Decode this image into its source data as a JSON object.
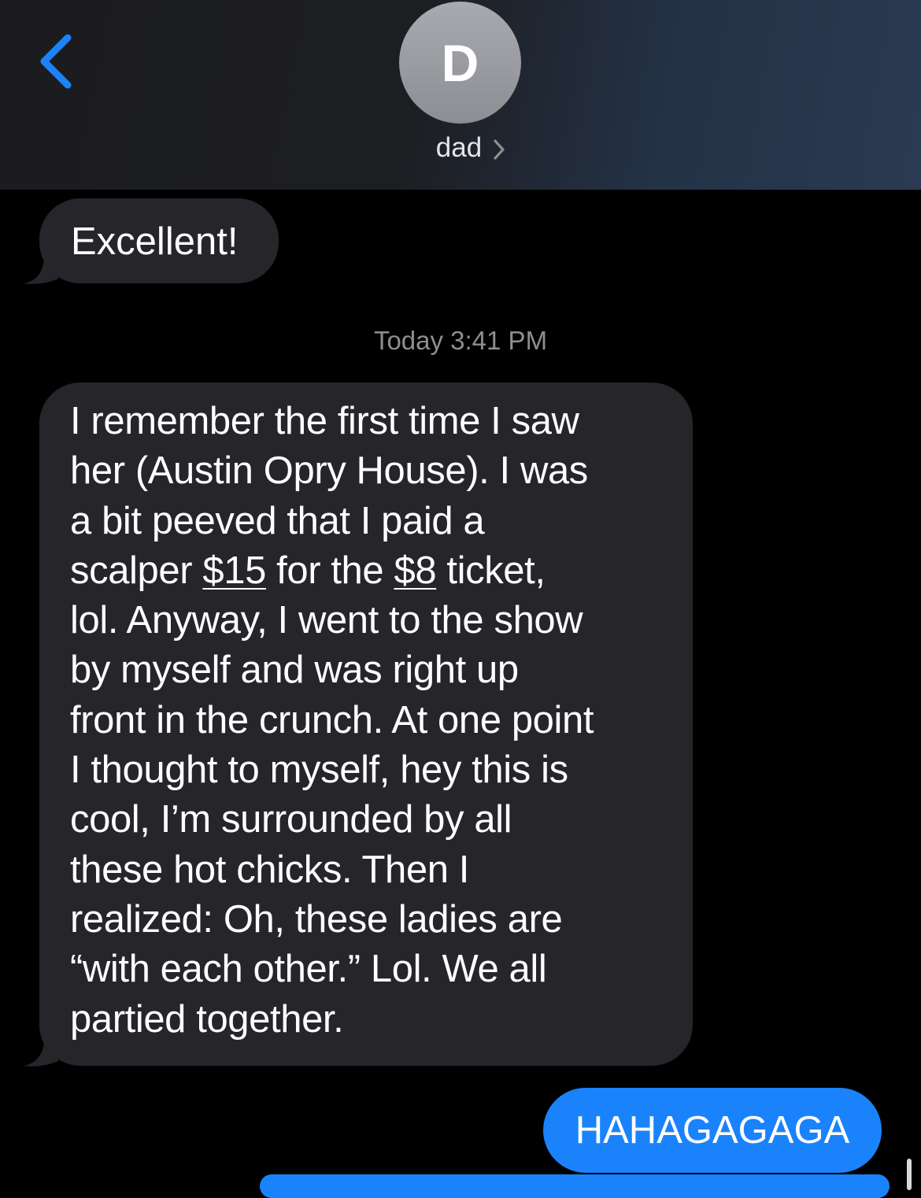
{
  "colors": {
    "header_bg": "#1c1c1e",
    "incoming_bubble": "#26252a",
    "outgoing_bubble": "#1a83fb",
    "back_accent": "#1a83fb",
    "timestamp_text": "#8e8e93"
  },
  "header": {
    "back_icon": "chevron-left-icon",
    "avatar_initial": "D",
    "contact_name": "dad",
    "contact_chevron_icon": "chevron-right-icon"
  },
  "messages": [
    {
      "direction": "incoming",
      "text": "Excellent!"
    },
    {
      "type": "timestamp",
      "text": "Today 3:41 PM"
    },
    {
      "direction": "incoming",
      "lines": [
        "I remember the first time I saw",
        "her (Austin Opry House). I was",
        "a bit peeved that I paid a",
        [
          "scalper ",
          "$15",
          " for the ",
          "$8",
          " ticket,"
        ],
        "lol. Anyway, I went to the show",
        "by myself and was right up",
        "front in the crunch. At one point",
        "I thought to myself, hey this is",
        "cool, I’m surrounded by all",
        "these hot chicks. Then I",
        "realized: Oh, these ladies are",
        "“with each other.” Lol. We all",
        "partied together."
      ]
    },
    {
      "direction": "outgoing",
      "text": "HAHAGAGAGA"
    }
  ]
}
